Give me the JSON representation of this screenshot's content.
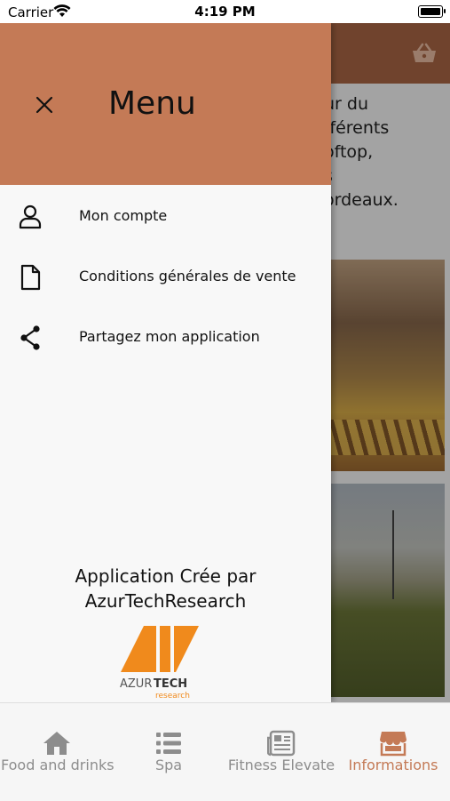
{
  "status_bar": {
    "carrier": "Carrier",
    "time": "4:19 PM"
  },
  "background_page": {
    "header_color": "#b06a47",
    "text_fragment": "ur du\nfférents\noftop,\ns\nordeaux."
  },
  "drawer": {
    "title": "Menu",
    "header_color": "#c47a56",
    "items": [
      {
        "label": "Mon compte",
        "icon": "user-icon"
      },
      {
        "label": "Conditions générales de vente",
        "icon": "document-icon"
      },
      {
        "label": "Partagez mon application",
        "icon": "share-icon"
      }
    ],
    "credit_line1": "Application Crée par",
    "credit_line2": "AzurTechResearch",
    "logo_text": "AZURTECH research"
  },
  "tabbar": {
    "active_color": "#c47a56",
    "inactive_color": "#8d8d8d",
    "tabs": [
      {
        "label": "Food and drinks",
        "icon": "home-icon",
        "active": false
      },
      {
        "label": "Spa",
        "icon": "list-icon",
        "active": false
      },
      {
        "label": "Fitness Elevate",
        "icon": "newspaper-icon",
        "active": false
      },
      {
        "label": "Informations",
        "icon": "store-icon",
        "active": true
      }
    ]
  }
}
